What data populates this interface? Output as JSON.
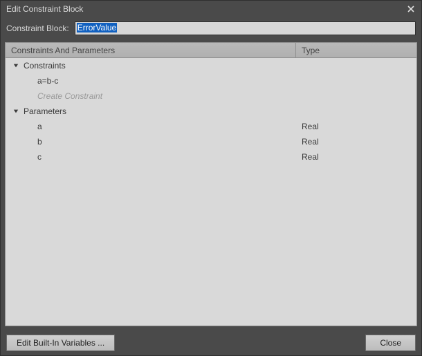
{
  "dialog": {
    "title": "Edit Constraint Block",
    "close_icon": "close"
  },
  "form": {
    "name_label": "Constraint Block:",
    "name_value": "ErrorValue",
    "name_selected": true
  },
  "columns": {
    "col1": "Constraints And Parameters",
    "col2": "Type"
  },
  "tree": {
    "constraints": {
      "label": "Constraints",
      "items": [
        {
          "expr": "a=b-c"
        }
      ],
      "create_placeholder": "Create Constraint"
    },
    "parameters": {
      "label": "Parameters",
      "items": [
        {
          "name": "a",
          "type": "Real"
        },
        {
          "name": "b",
          "type": "Real"
        },
        {
          "name": "c",
          "type": "Real"
        }
      ]
    }
  },
  "footer": {
    "edit_builtins": "Edit Built-In Variables ...",
    "close": "Close"
  }
}
